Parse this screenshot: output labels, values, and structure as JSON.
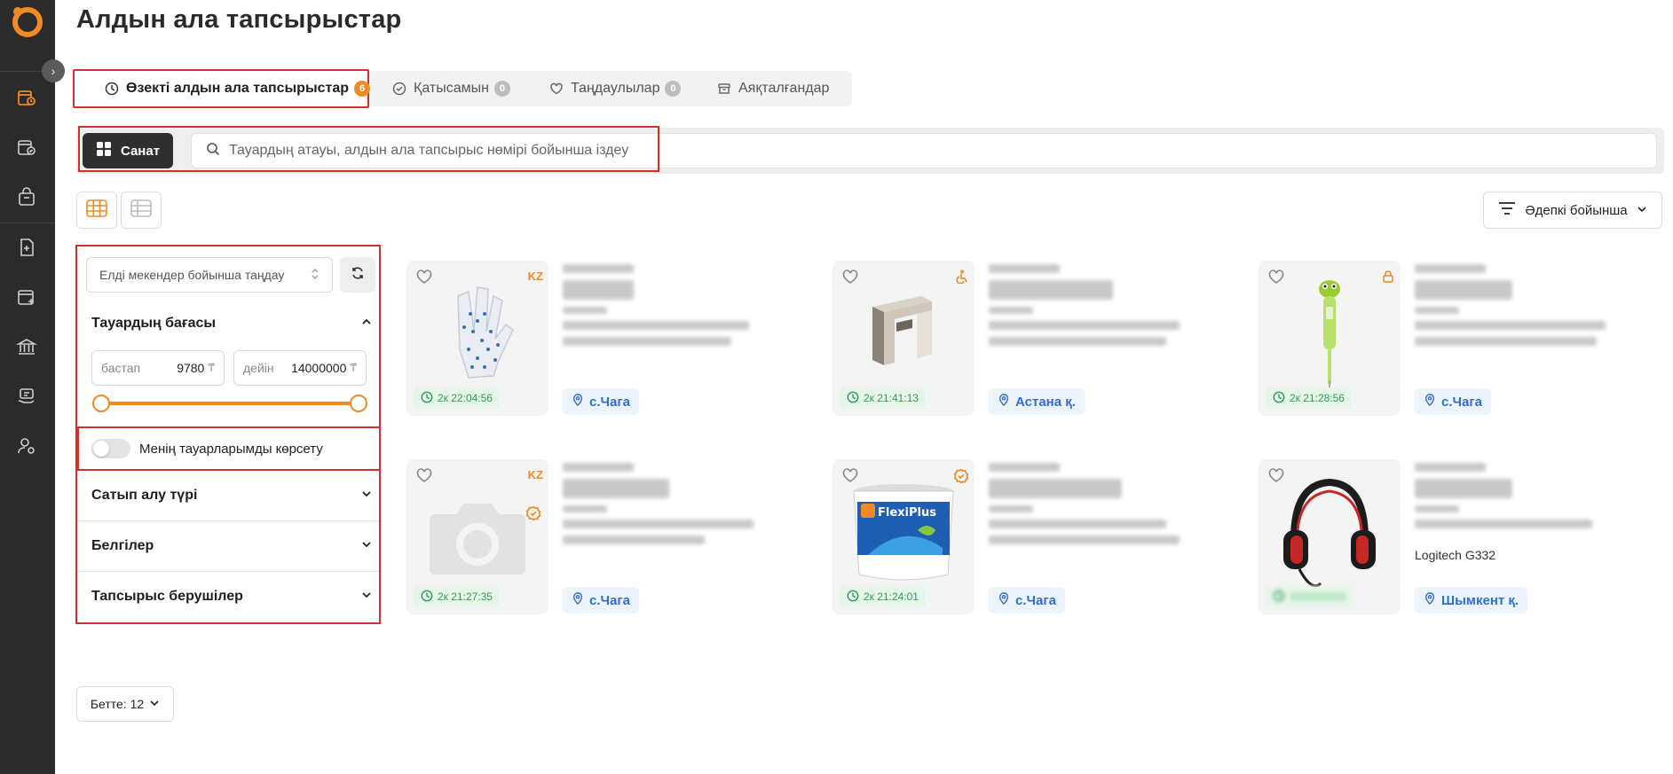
{
  "page": {
    "title": "Алдын ала тапсырыстар"
  },
  "tabs": [
    {
      "label": "Өзекті алдын ала тапсырыстар",
      "count": "6",
      "icon": "clock-icon",
      "active": true
    },
    {
      "label": "Қатысамын",
      "count": "0",
      "icon": "check-circle-icon"
    },
    {
      "label": "Таңдаулылар",
      "count": "0",
      "icon": "heart-icon"
    },
    {
      "label": "Аяқталғандар",
      "count": "",
      "icon": "archive-icon"
    }
  ],
  "search": {
    "category_label": "Санат",
    "placeholder": "Тауардың атауы, алдын ала тапсырыс нөмірі бойынша іздеу"
  },
  "sort": {
    "label": "Әдепкі бойынша"
  },
  "filters": {
    "region_placeholder": "Елді мекендер бойынша таңдау",
    "price": {
      "title": "Тауардың бағасы",
      "from_label": "бастап",
      "from_value": "9780",
      "to_label": "дейін",
      "to_value": "14000000",
      "currency": "₸"
    },
    "my_goods_label": "Менің тауарларымды көрсету",
    "purchase_type": "Сатып алу түрі",
    "tags": "Белгілер",
    "customers": "Тапсырыс берушілер"
  },
  "cards": [
    {
      "timer": "2к 22:04:56",
      "location": "с.Чага",
      "corner": "KZ",
      "image": "gloves"
    },
    {
      "timer": "2к 21:41:13",
      "location": "Астана қ.",
      "corner": "accessible-icon",
      "image": "desk"
    },
    {
      "timer": "2к 21:28:56",
      "location": "с.Чага",
      "corner": "lock-icon",
      "image": "thermometer"
    },
    {
      "timer": "2к 21:27:35",
      "location": "с.Чага",
      "corner": "KZ",
      "image": "camera-placeholder"
    },
    {
      "timer": "2к 21:24:01",
      "location": "с.Чага",
      "corner": "verified-icon",
      "image": "paint-bucket",
      "brand": "FlexiPlus"
    },
    {
      "timer": "",
      "location": "Шымкент қ.",
      "corner": "",
      "image": "headset",
      "visible_text": "Logitech G332"
    }
  ],
  "pagination": {
    "per_page_label": "Бетте: 12"
  },
  "colors": {
    "accent": "#f08a24",
    "sidebar": "#2b2b2b",
    "highlight": "#d32f2f",
    "timer_green": "#2e9e4f",
    "location_blue": "#2f6ed3"
  }
}
